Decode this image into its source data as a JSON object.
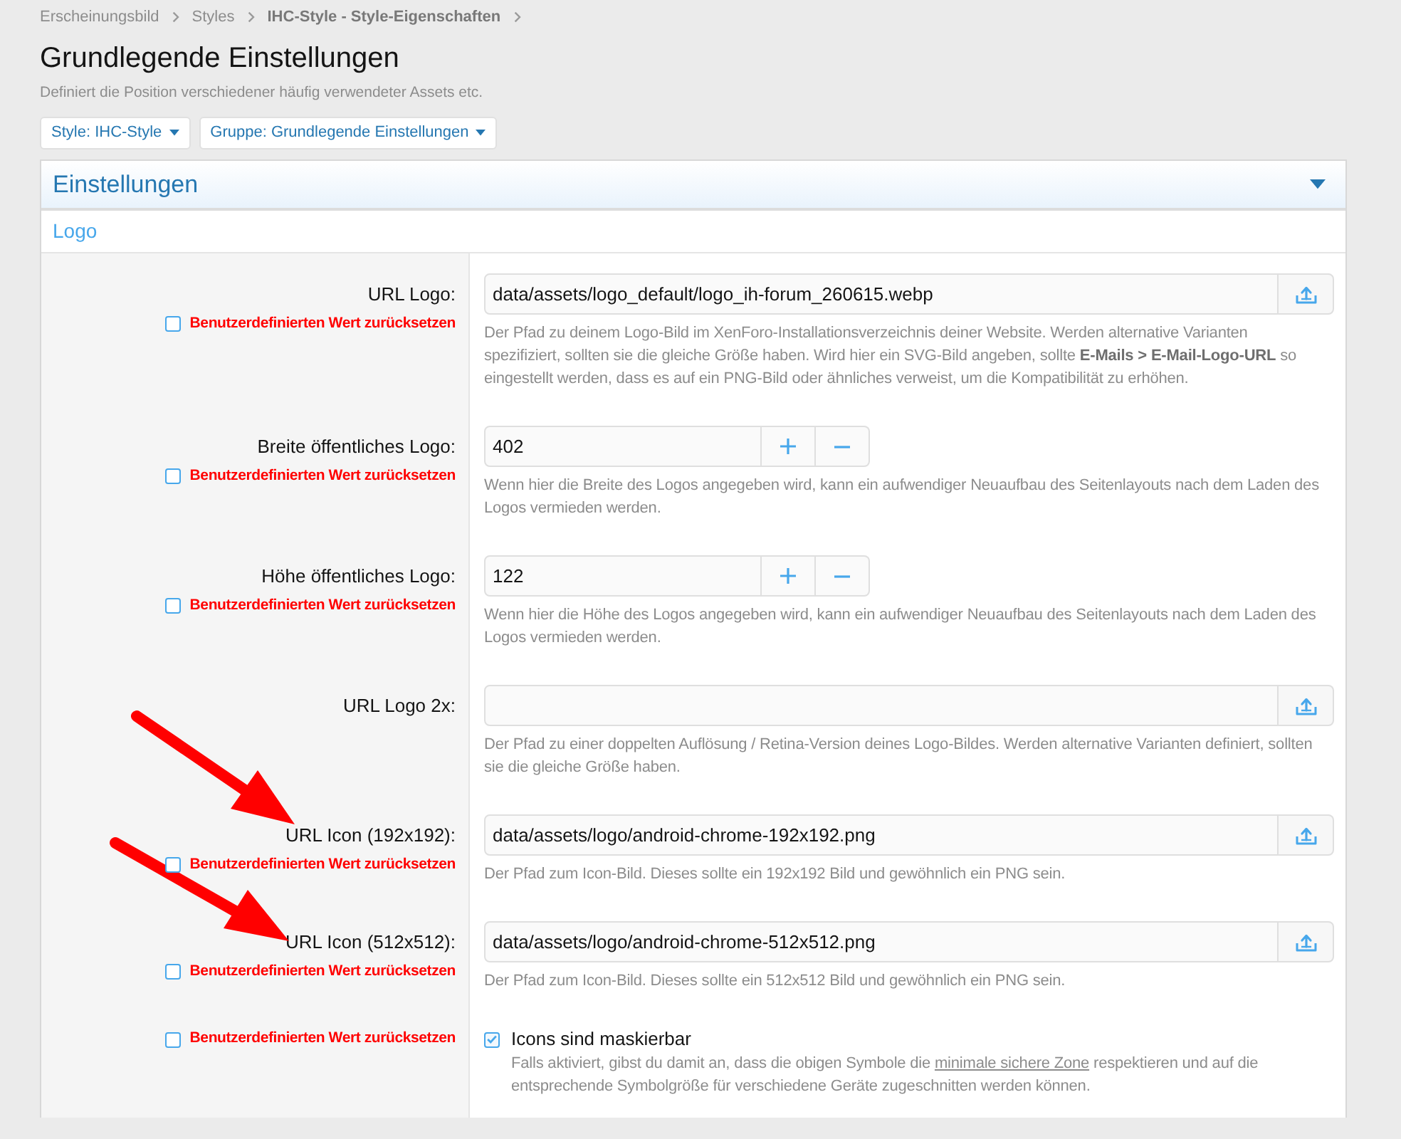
{
  "breadcrumb": [
    {
      "label": "Erscheinungsbild",
      "current": false
    },
    {
      "label": "Styles",
      "current": false
    },
    {
      "label": "IHC-Style - Style-Eigenschaften",
      "current": true
    }
  ],
  "page": {
    "title": "Grundlegende Einstellungen",
    "description": "Definiert die Position verschiedener häufig verwendeter Assets etc."
  },
  "filters": [
    {
      "label": "Style: IHC-Style"
    },
    {
      "label": "Gruppe: Grundlegende Einstellungen"
    }
  ],
  "panel": {
    "title": "Einstellungen",
    "expanded": true,
    "section": "Logo",
    "rows": [
      {
        "kind": "upload",
        "label": "URL Logo:",
        "value": "data/assets/logo_default/logo_ih-forum_260615.webp",
        "reset": {
          "label": "Benutzerdefinierten Wert zurücksetzen",
          "checked": false
        },
        "description": "Der Pfad zu deinem Logo-Bild im XenForo-Installationsverzeichnis deiner Website. Werden alternative Varianten spezifiziert, sollten sie die gleiche Größe haben. Wird hier ein SVG-Bild angeben, sollte **E-Mails > E-Mail-Logo-URL** so eingestellt werden, dass es auf ein PNG-Bild oder ähnliches verweist, um die Kompatibilität zu erhöhen."
      },
      {
        "kind": "number",
        "label": "Breite öffentliches Logo:",
        "value": "402",
        "reset": {
          "label": "Benutzerdefinierten Wert zurücksetzen",
          "checked": false
        },
        "description": "Wenn hier die Breite des Logos angegeben wird, kann ein aufwendiger Neuaufbau des Seitenlayouts nach dem Laden des Logos vermieden werden."
      },
      {
        "kind": "number",
        "label": "Höhe öffentliches Logo:",
        "value": "122",
        "reset": {
          "label": "Benutzerdefinierten Wert zurücksetzen",
          "checked": false
        },
        "description": "Wenn hier die Höhe des Logos angegeben wird, kann ein aufwendiger Neuaufbau des Seitenlayouts nach dem Laden des Logos vermieden werden."
      },
      {
        "kind": "upload",
        "label": "URL Logo 2x:",
        "description": "Der Pfad zu einer doppelten Auflösung / Retina-Version deines Logo-Bildes. Werden alternative Varianten definiert, sollten sie die gleiche Größe haben."
      },
      {
        "kind": "upload",
        "label": "URL Icon (192x192):",
        "value": "data/assets/logo/android-chrome-192x192.png",
        "reset": {
          "label": "Benutzerdefinierten Wert zurücksetzen",
          "checked": false
        },
        "description": "Der Pfad zum Icon-Bild. Dieses sollte ein 192x192 Bild und gewöhnlich ein PNG sein."
      },
      {
        "kind": "upload",
        "label": "URL Icon (512x512):",
        "value": "data/assets/logo/android-chrome-512x512.png",
        "reset": {
          "label": "Benutzerdefinierten Wert zurücksetzen",
          "checked": false
        },
        "description": "Der Pfad zum Icon-Bild. Dieses sollte ein 512x512 Bild und gewöhnlich ein PNG sein."
      },
      {
        "kind": "checkbox",
        "option_label": "Icons sind maskierbar",
        "checked": true,
        "reset": {
          "label": "Benutzerdefinierten Wert zurücksetzen",
          "checked": false
        },
        "description": [
          {
            "kind": "text",
            "text": "Falls aktiviert, gibst du damit an, dass die obigen Symbole die "
          },
          {
            "kind": "link",
            "text": "minimale sichere Zone"
          },
          {
            "kind": "text",
            "text": " respektieren und auf die entsprechende Symbolgröße für verschiedene Geräte zugeschnitten werden können."
          }
        ]
      }
    ]
  }
}
